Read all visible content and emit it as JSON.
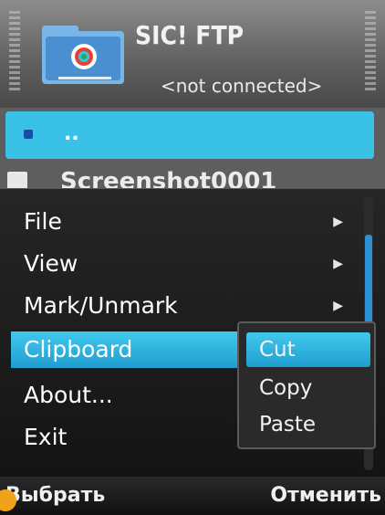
{
  "header": {
    "title": "SIC! FTP",
    "status": "<not connected>"
  },
  "list": {
    "selected": "..",
    "second": "Screenshot0001"
  },
  "menu": {
    "items": [
      {
        "label": "File"
      },
      {
        "label": "View"
      },
      {
        "label": "Mark/Unmark"
      },
      {
        "label": "Clipboard"
      },
      {
        "label": "About..."
      },
      {
        "label": "Exit"
      }
    ],
    "submenu": [
      {
        "label": "Cut"
      },
      {
        "label": "Copy"
      },
      {
        "label": "Paste"
      }
    ],
    "arrow_glyph": "▶"
  },
  "softkeys": {
    "left": "Выбрать",
    "right": "Отменить"
  },
  "colors": {
    "accent": "#39c1e8",
    "highlight": "#1f9ecf"
  }
}
